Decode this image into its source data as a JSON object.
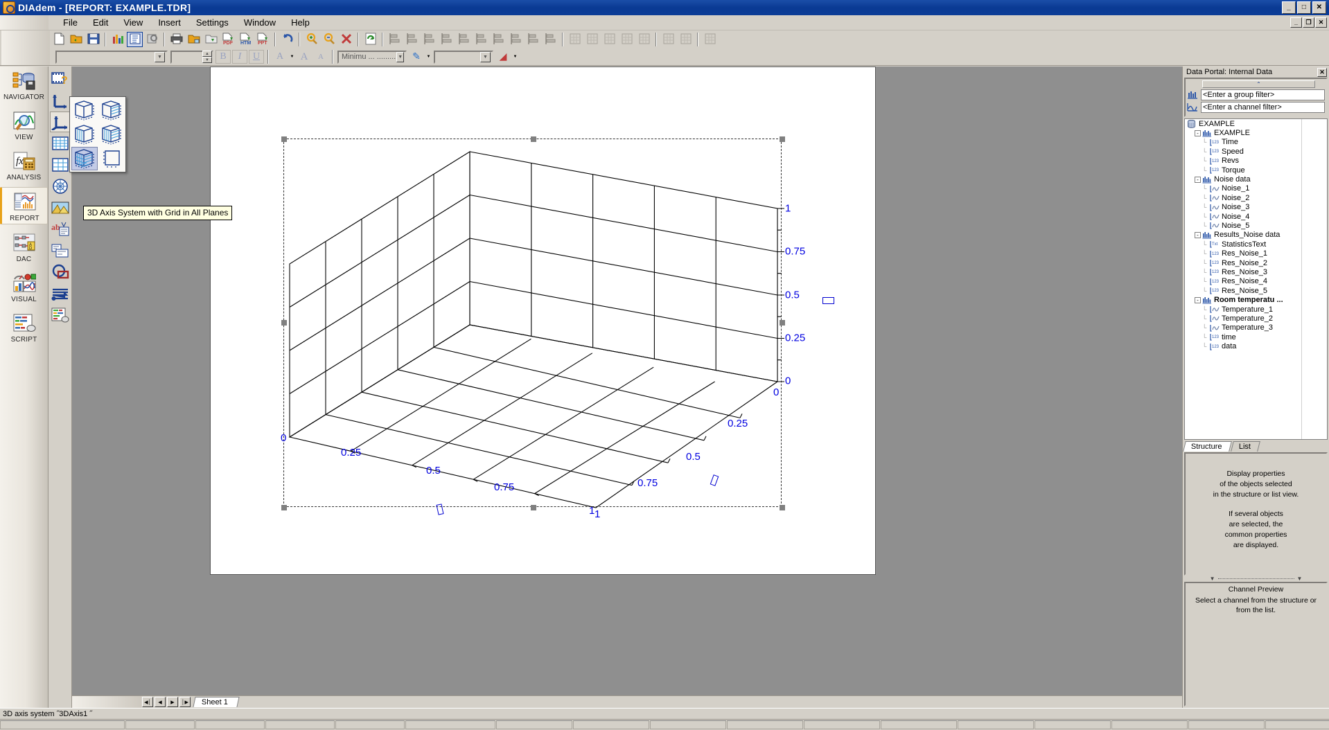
{
  "window": {
    "title": "DIAdem - [REPORT:   EXAMPLE.TDR]",
    "icon": "diadem-app-icon",
    "buttons": {
      "minimize": "_",
      "maximize": "□",
      "close": "✕"
    },
    "mdi_buttons": {
      "minimize": "_",
      "restore": "❐",
      "close": "✕"
    }
  },
  "menu": {
    "items": [
      {
        "label": "File"
      },
      {
        "label": "Edit"
      },
      {
        "label": "View"
      },
      {
        "label": "Insert"
      },
      {
        "label": "Settings"
      },
      {
        "label": "Window"
      },
      {
        "label": "Help"
      }
    ]
  },
  "toolbar": {
    "row1": [
      {
        "name": "new-document",
        "glyph": "⬜"
      },
      {
        "name": "open-document",
        "glyph": "📂"
      },
      {
        "name": "save-document",
        "glyph": "💾"
      },
      {
        "name": "sep",
        "glyph": ""
      },
      {
        "name": "chart-view",
        "glyph": "📊"
      },
      {
        "name": "report-structure",
        "glyph": "≣"
      },
      {
        "name": "print-preview-zoom",
        "glyph": "🔍"
      },
      {
        "name": "sep",
        "glyph": ""
      },
      {
        "name": "print",
        "glyph": "🖨"
      },
      {
        "name": "export-graphic",
        "glyph": "🖼"
      },
      {
        "name": "export-clipboard",
        "glyph": "📋"
      },
      {
        "name": "export-pdf",
        "glyph": "PDF"
      },
      {
        "name": "export-html",
        "glyph": "HTM"
      },
      {
        "name": "export-ppt",
        "glyph": "PPT"
      },
      {
        "name": "sep",
        "glyph": ""
      },
      {
        "name": "undo",
        "glyph": "↶"
      },
      {
        "name": "sep",
        "glyph": ""
      },
      {
        "name": "zoom-in",
        "glyph": "+"
      },
      {
        "name": "zoom-out",
        "glyph": "−"
      },
      {
        "name": "delete-object",
        "glyph": "✕"
      },
      {
        "name": "sep",
        "glyph": ""
      },
      {
        "name": "refresh",
        "glyph": "↻"
      },
      {
        "name": "sep",
        "glyph": ""
      },
      {
        "name": "align-left",
        "glyph": "⸨"
      },
      {
        "name": "align-right",
        "glyph": "⸩"
      },
      {
        "name": "align-top",
        "glyph": "⤒"
      },
      {
        "name": "align-bottom",
        "glyph": "⤓"
      },
      {
        "name": "align-center-h",
        "glyph": "↔"
      },
      {
        "name": "align-center-v",
        "glyph": "↕"
      },
      {
        "name": "distribute-h",
        "glyph": "▤"
      },
      {
        "name": "distribute-v",
        "glyph": "▥"
      },
      {
        "name": "same-width",
        "glyph": "▭"
      },
      {
        "name": "same-height",
        "glyph": "▯"
      },
      {
        "name": "sep",
        "glyph": ""
      },
      {
        "name": "grid-new",
        "glyph": "⊞"
      },
      {
        "name": "grid-settings",
        "glyph": "▦"
      },
      {
        "name": "grid-insert-row",
        "glyph": "▦"
      },
      {
        "name": "grid-insert-col",
        "glyph": "▦"
      },
      {
        "name": "grid-delete",
        "glyph": "▦"
      },
      {
        "name": "sep",
        "glyph": ""
      },
      {
        "name": "layout-assign",
        "glyph": "🖊"
      },
      {
        "name": "layout-clear",
        "glyph": "✂"
      },
      {
        "name": "sep",
        "glyph": ""
      },
      {
        "name": "variable-link",
        "glyph": "▤"
      }
    ],
    "row2": {
      "font_family": {
        "name": "font-family-combo",
        "value": ""
      },
      "font_size": {
        "name": "font-size-combo",
        "value": ""
      },
      "bold": "B",
      "italic": "I",
      "underline": "U",
      "text_color": {
        "name": "text-color-button",
        "glyph": "A"
      },
      "grow_font": "A",
      "shrink_font": "A",
      "line_style": {
        "name": "line-style-combo",
        "value": "Minimu ... ......................."
      },
      "pen_color": {
        "name": "pen-color-button",
        "glyph": "✎"
      },
      "line_weight": {
        "name": "line-weight-combo",
        "value": ""
      },
      "fill_color": {
        "name": "fill-color-button",
        "glyph": "◢"
      }
    }
  },
  "rail": {
    "items": [
      {
        "label": "NAVIGATOR",
        "icon": "navigator-icon",
        "active": false
      },
      {
        "label": "VIEW",
        "icon": "view-icon",
        "active": false
      },
      {
        "label": "ANALYSIS",
        "icon": "analysis-icon",
        "active": false
      },
      {
        "label": "REPORT",
        "icon": "report-icon",
        "active": true
      },
      {
        "label": "DAC",
        "icon": "dac-icon",
        "active": false
      },
      {
        "label": "VISUAL",
        "icon": "visual-icon",
        "active": false
      },
      {
        "label": "SCRIPT",
        "icon": "script-icon",
        "active": false
      }
    ]
  },
  "palette": {
    "items": [
      {
        "name": "tool-image-placeholder",
        "icon": "film-question-icon"
      },
      {
        "name": "tool-2d-axis",
        "icon": "axis-2d-icon"
      },
      {
        "name": "tool-3d-axis",
        "icon": "axis-3d-icon",
        "selected": true
      },
      {
        "name": "tool-table",
        "icon": "table-icon"
      },
      {
        "name": "tool-table-2",
        "icon": "table-alt-icon"
      },
      {
        "name": "tool-polar-axis",
        "icon": "polar-axis-icon"
      },
      {
        "name": "tool-picture",
        "icon": "picture-icon"
      },
      {
        "name": "tool-text",
        "icon": "text-ab-icon"
      },
      {
        "name": "tool-variable-box",
        "icon": "variable-box-icon"
      },
      {
        "name": "tool-shapes",
        "icon": "shapes-icon"
      },
      {
        "name": "tool-lines",
        "icon": "lines-icon"
      },
      {
        "name": "tool-legend",
        "icon": "legend-icon"
      }
    ]
  },
  "flyout": {
    "items": [
      {
        "name": "3d-axis-plain",
        "selected": false
      },
      {
        "name": "3d-axis-grid-back",
        "selected": false
      },
      {
        "name": "3d-axis-grid-left",
        "selected": false
      },
      {
        "name": "3d-axis-grid-two-planes",
        "selected": false
      },
      {
        "name": "3d-axis-grid-all-planes",
        "selected": true
      },
      {
        "name": "3d-axis-no-grid",
        "selected": false
      }
    ]
  },
  "tooltip": {
    "text": "3D Axis System with Grid in All Planes"
  },
  "chart_data": {
    "type": "line",
    "title": "",
    "subtitle": "",
    "xlabel": "",
    "ylabel": "",
    "zlabel": "",
    "grid": true,
    "legend": "none",
    "object_name": "3DAxis1",
    "xlim": [
      0,
      1
    ],
    "ylim": [
      0,
      1
    ],
    "zlim": [
      0,
      1
    ],
    "x_ticks": [
      "0",
      "0.25",
      "0.5",
      "0.75",
      "1"
    ],
    "y_ticks": [
      "0",
      "0.25",
      "0.5",
      "0.75",
      "1"
    ],
    "z_ticks": [
      "0",
      "0.25",
      "0.5",
      "0.75",
      "1"
    ],
    "series": [],
    "note": "Empty 3D axis system with grid lines drawn on all three planes; no data curves plotted."
  },
  "sheet_tabs": {
    "nav": {
      "first": "◀│",
      "prev": "◀",
      "next": "▶",
      "last": "│▶"
    },
    "tabs": [
      {
        "label": "Sheet 1",
        "active": true
      }
    ]
  },
  "portal": {
    "title": "Data Portal: Internal Data",
    "close": "✕",
    "collapse": "⌃",
    "group_filter": {
      "placeholder": "<Enter a group filter>",
      "value": "<Enter a group filter>",
      "icon": "group-filter-icon"
    },
    "channel_filter": {
      "placeholder": "<Enter a channel filter>",
      "value": "<Enter a channel filter>",
      "icon": "channel-filter-icon"
    },
    "tree": [
      {
        "label": "EXAMPLE",
        "level": 0,
        "icon": "database-icon",
        "expander": "",
        "bold": false
      },
      {
        "label": "EXAMPLE",
        "level": 1,
        "icon": "group-icon",
        "expander": "-",
        "bold": false
      },
      {
        "label": "Time",
        "level": 2,
        "icon": "numeric-channel-icon",
        "expander": "",
        "bold": false
      },
      {
        "label": "Speed",
        "level": 2,
        "icon": "numeric-channel-icon",
        "expander": "",
        "bold": false
      },
      {
        "label": "Revs",
        "level": 2,
        "icon": "numeric-channel-icon",
        "expander": "",
        "bold": false
      },
      {
        "label": "Torque",
        "level": 2,
        "icon": "numeric-channel-icon",
        "expander": "",
        "bold": false
      },
      {
        "label": "Noise data",
        "level": 1,
        "icon": "group-icon",
        "expander": "-",
        "bold": false
      },
      {
        "label": "Noise_1",
        "level": 2,
        "icon": "waveform-channel-icon",
        "expander": "",
        "bold": false
      },
      {
        "label": "Noise_2",
        "level": 2,
        "icon": "waveform-channel-icon",
        "expander": "",
        "bold": false
      },
      {
        "label": "Noise_3",
        "level": 2,
        "icon": "waveform-channel-icon",
        "expander": "",
        "bold": false
      },
      {
        "label": "Noise_4",
        "level": 2,
        "icon": "waveform-channel-icon",
        "expander": "",
        "bold": false
      },
      {
        "label": "Noise_5",
        "level": 2,
        "icon": "waveform-channel-icon",
        "expander": "",
        "bold": false
      },
      {
        "label": "Results_Noise data",
        "level": 1,
        "icon": "group-icon",
        "expander": "-",
        "bold": false
      },
      {
        "label": "StatisticsText",
        "level": 2,
        "icon": "text-channel-icon",
        "expander": "",
        "bold": false
      },
      {
        "label": "Res_Noise_1",
        "level": 2,
        "icon": "numeric-channel-icon",
        "expander": "",
        "bold": false
      },
      {
        "label": "Res_Noise_2",
        "level": 2,
        "icon": "numeric-channel-icon",
        "expander": "",
        "bold": false
      },
      {
        "label": "Res_Noise_3",
        "level": 2,
        "icon": "numeric-channel-icon",
        "expander": "",
        "bold": false
      },
      {
        "label": "Res_Noise_4",
        "level": 2,
        "icon": "numeric-channel-icon",
        "expander": "",
        "bold": false
      },
      {
        "label": "Res_Noise_5",
        "level": 2,
        "icon": "numeric-channel-icon",
        "expander": "",
        "bold": false
      },
      {
        "label": "Room temperatu ...",
        "level": 1,
        "icon": "group-icon",
        "expander": "-",
        "bold": true
      },
      {
        "label": "Temperature_1",
        "level": 2,
        "icon": "waveform-channel-icon",
        "expander": "",
        "bold": false
      },
      {
        "label": "Temperature_2",
        "level": 2,
        "icon": "waveform-channel-icon",
        "expander": "",
        "bold": false
      },
      {
        "label": "Temperature_3",
        "level": 2,
        "icon": "waveform-channel-icon",
        "expander": "",
        "bold": false
      },
      {
        "label": "time",
        "level": 2,
        "icon": "numeric-channel-icon",
        "expander": "",
        "bold": false
      },
      {
        "label": "data",
        "level": 2,
        "icon": "numeric-channel-icon",
        "expander": "",
        "bold": false
      }
    ],
    "view_tabs": [
      {
        "label": "Structure",
        "active": true
      },
      {
        "label": "List",
        "active": false
      }
    ],
    "properties_hint": [
      "Display properties",
      "of the objects selected",
      "in the structure or list view.",
      "",
      "If several objects",
      "are selected, the",
      "common properties",
      "are displayed."
    ],
    "channel_preview": {
      "title": "Channel Preview",
      "lines": [
        "Select a channel from the structure or",
        "from the list."
      ]
    }
  },
  "statusbar": {
    "text": "3D axis system ˝3DAxis1 ˝"
  },
  "colors": {
    "title_bar": "#0a3a93",
    "chrome": "#d4d0c8",
    "axis_label": "#0000e0",
    "doc_background": "#8f8f8f",
    "accent_orange": "#e8a21a",
    "tooltip_bg": "#ffffe1"
  }
}
